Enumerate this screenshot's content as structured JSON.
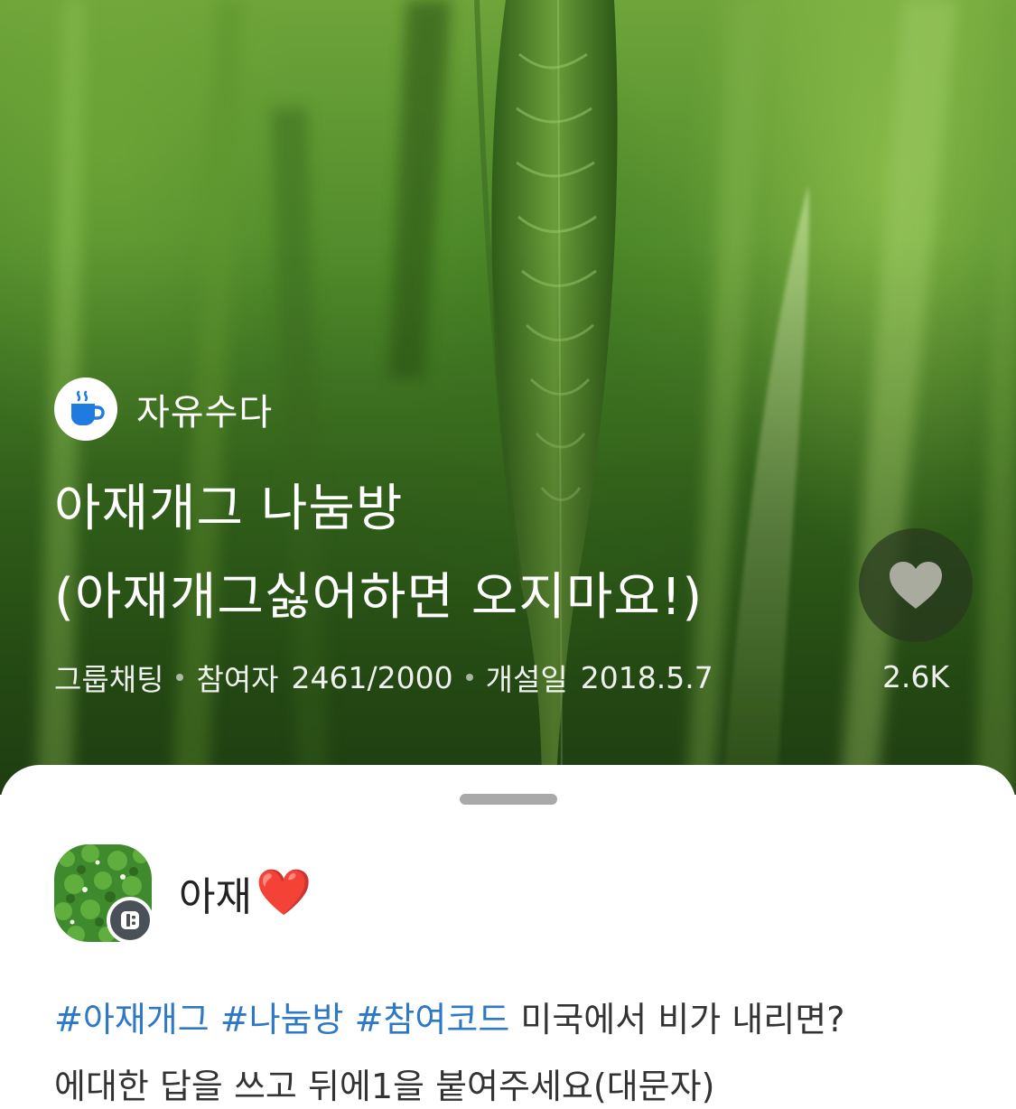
{
  "cover": {
    "category_label": "자유수다",
    "title_lines": [
      "아재개그 나눔방",
      "(아재개그싫어하면 오지마요!)"
    ],
    "meta": {
      "type": "그룹채팅",
      "participants_label": "참여자",
      "participants": "2461/2000",
      "opened_label": "개설일",
      "opened_date": "2018.5.7"
    },
    "likes": "2.6K"
  },
  "host": {
    "name": "아재",
    "name_emoji": "❤️"
  },
  "description": {
    "tags": [
      "#아재개그",
      "#나눔방",
      "#참여코드"
    ],
    "line1_text": "미국에서 비가 내리면?",
    "line2_text": "에대한 답을 쓰고 뒤에1을 붙여주세요(대문자)"
  },
  "colors": {
    "tag": "#2e78c6",
    "category_icon": "#1f7be0",
    "host_badge": "#4a5057"
  }
}
